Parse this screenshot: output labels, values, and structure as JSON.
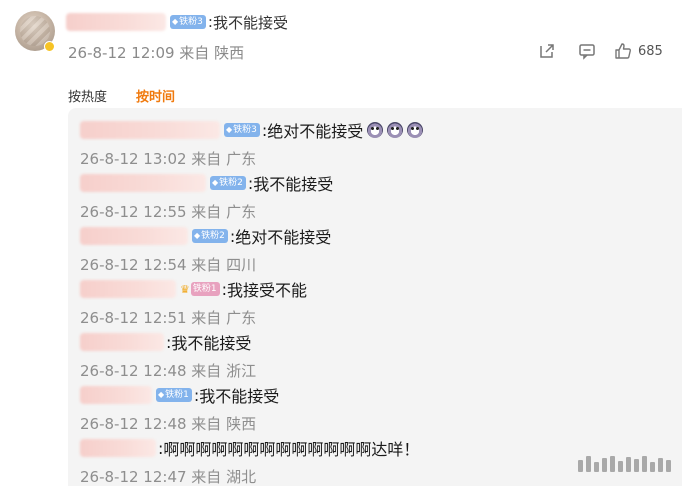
{
  "main_comment": {
    "author_badge": "铁粉3",
    "text": "我不能接受",
    "meta": "26-8-12 12:09 来自 陕西",
    "like_count": "685",
    "icons": [
      "share-icon",
      "comment-icon",
      "like-icon"
    ]
  },
  "sort": {
    "hot_label": "按热度",
    "time_label": "按时间",
    "active_color": "#f07a0e"
  },
  "replies": [
    {
      "badge": "铁粉3",
      "text": "绝对不能接受",
      "emoji_count": 3,
      "meta": "26-8-12 13:02 来自 广东"
    },
    {
      "badge": "铁粉2",
      "text": "我不能接受",
      "meta": "26-8-12 12:55 来自 广东"
    },
    {
      "badge": "铁粉2",
      "text": "绝对不能接受",
      "meta": "26-8-12 12:54 来自 四川"
    },
    {
      "badge": "铁粉1",
      "badge_style": "crown",
      "text": "我接受不能",
      "meta": "26-8-12 12:51 来自 广东"
    },
    {
      "badge": "",
      "text": "我不能接受",
      "meta": "26-8-12 12:48 来自 浙江"
    },
    {
      "badge": "铁粉1",
      "text": "我不能接受",
      "meta": "26-8-12 12:48 来自 陕西"
    },
    {
      "badge": "",
      "text": "啊啊啊啊啊啊啊啊啊啊啊啊啊达咩！",
      "meta": "26-8-12 12:47 来自 湖北"
    }
  ],
  "colors": {
    "badge_blue": "#83b3ec",
    "panel_bg": "#f4f4f4",
    "meta_gray": "#8e8e8e"
  }
}
